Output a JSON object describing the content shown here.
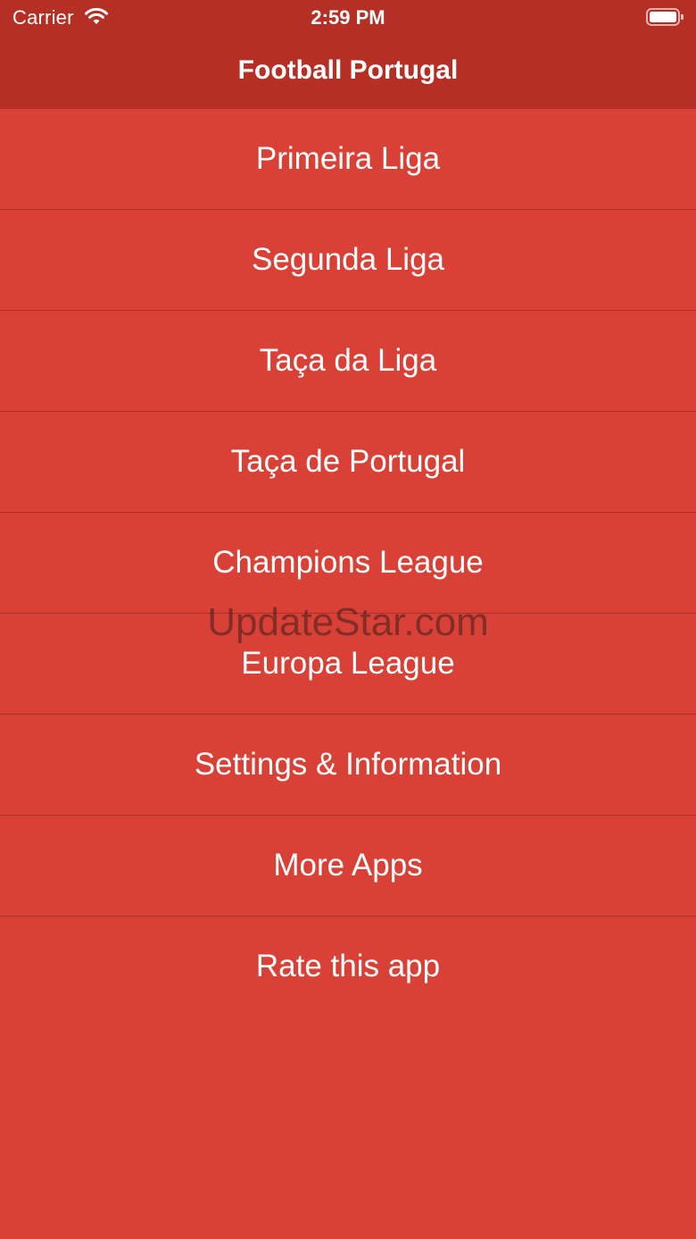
{
  "status_bar": {
    "carrier": "Carrier",
    "time": "2:59 PM"
  },
  "nav": {
    "title": "Football Portugal"
  },
  "menu": {
    "items": [
      {
        "label": "Primeira Liga"
      },
      {
        "label": "Segunda Liga"
      },
      {
        "label": "Taça da Liga"
      },
      {
        "label": "Taça de Portugal"
      },
      {
        "label": "Champions League"
      },
      {
        "label": "Europa League"
      },
      {
        "label": "Settings & Information"
      },
      {
        "label": "More Apps"
      },
      {
        "label": "Rate this app"
      }
    ]
  },
  "watermark": "UpdateStar.com",
  "colors": {
    "background": "#d94136",
    "bar": "#b52f24",
    "separator": "#a73129",
    "text": "#ffffff"
  },
  "icons": {
    "wifi": "wifi-icon",
    "battery": "battery-icon"
  }
}
